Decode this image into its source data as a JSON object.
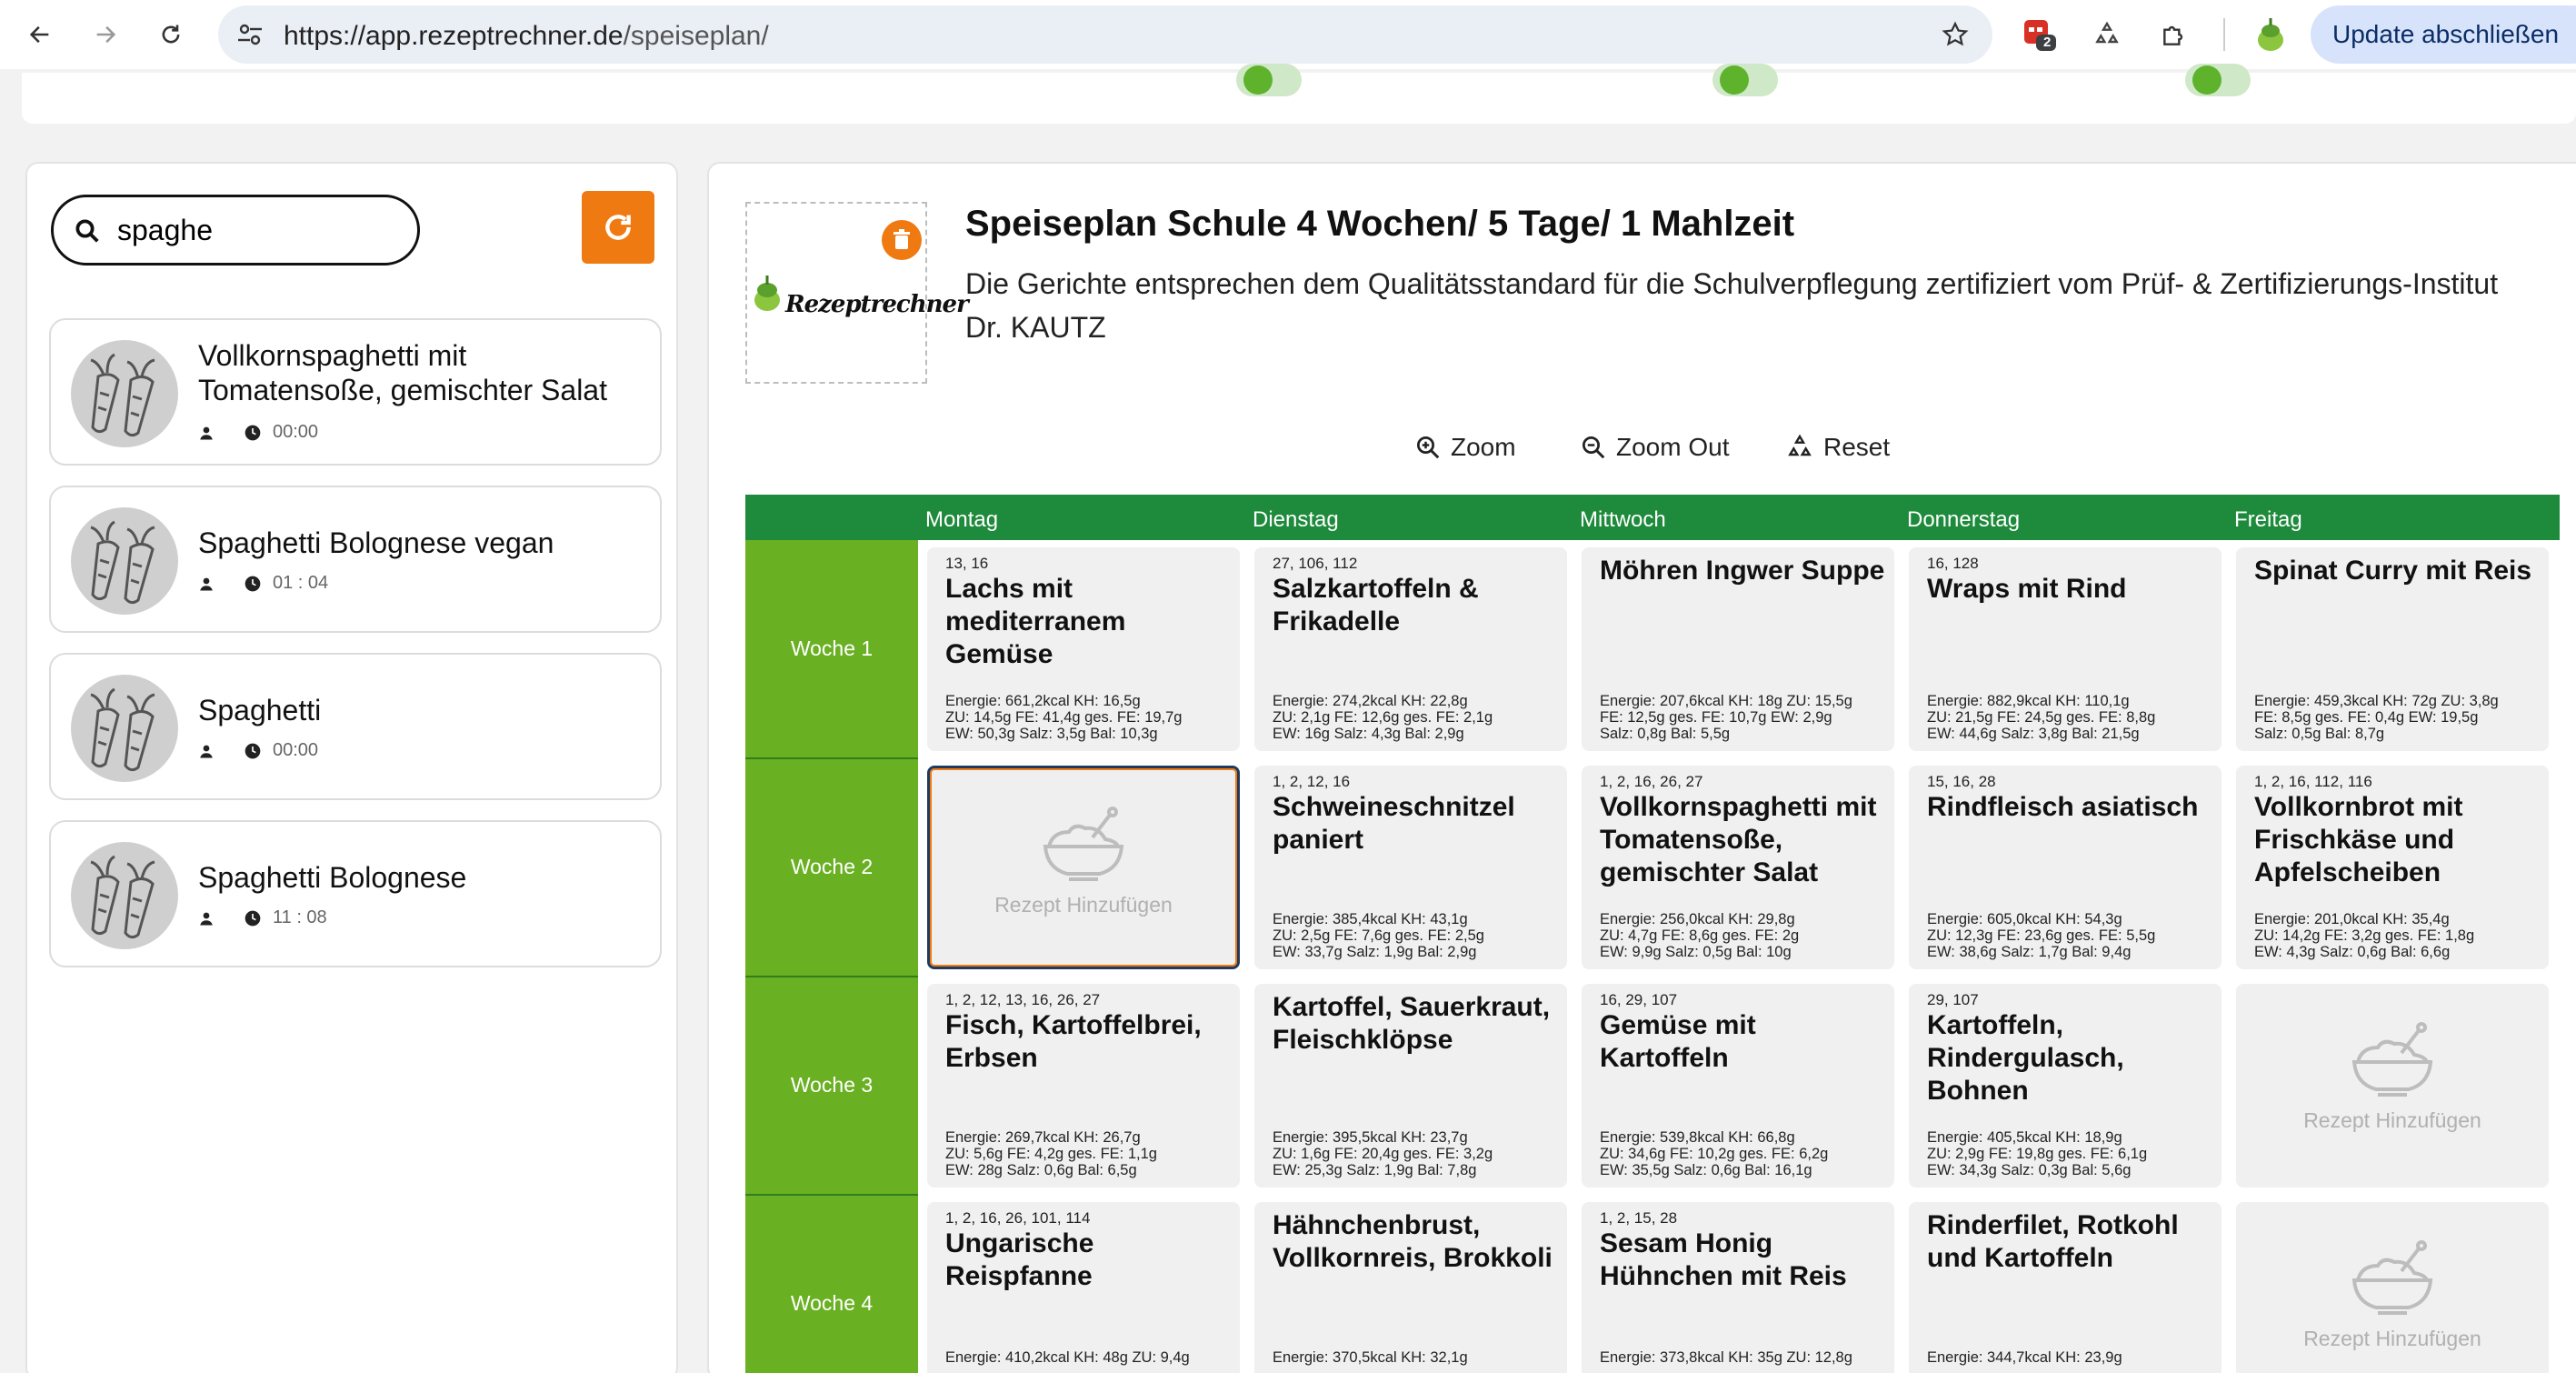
{
  "browser": {
    "url_host": "https://app.rezeptrechner.de",
    "url_path": "/speiseplan/",
    "ext_badge": "2",
    "update_label": "Update abschließen"
  },
  "search": {
    "value": "spaghe",
    "placeholder": ""
  },
  "recipes": [
    {
      "title": "Vollkornspaghetti mit Tomatensoße, gemischter Salat",
      "time": "00:00"
    },
    {
      "title": "Spaghetti Bolognese vegan",
      "time": "01 : 04"
    },
    {
      "title": "Spaghetti",
      "time": "00:00"
    },
    {
      "title": "Spaghetti Bolognese",
      "time": "11 : 08"
    }
  ],
  "plan": {
    "logo_text": "Rezeptrechner",
    "title": "Speiseplan Schule 4 Wochen/ 5 Tage/ 1 Mahlzeit",
    "subtitle": "Die Gerichte entsprechen dem Qualitätsstandard für die Schulverpflegung zertifiziert vom Prüf- & Zertifizierungs-Institut Dr. KAUTZ",
    "zoom_in": "Zoom",
    "zoom_out": "Zoom Out",
    "reset": "Reset",
    "add_label": "Rezept Hinzufügen",
    "days": [
      "Montag",
      "Dienstag",
      "Mittwoch",
      "Donnerstag",
      "Freitag"
    ],
    "weeks": [
      {
        "label": "Woche 1",
        "cells": [
          {
            "nums": "13, 16",
            "title": "Lachs mit mediterranem Gemüse",
            "n1": "Energie: 661,2kcal  KH: 16,5g",
            "n2": "ZU: 14,5g  FE: 41,4g  ges. FE: 19,7g",
            "n3": "EW: 50,3g  Salz: 3,5g  Bal: 10,3g"
          },
          {
            "nums": "27, 106, 112",
            "title": "Salzkartoffeln & Frikadelle",
            "n1": "Energie: 274,2kcal  KH: 22,8g",
            "n2": "ZU: 2,1g  FE: 12,6g  ges. FE: 2,1g",
            "n3": "EW: 16g  Salz: 4,3g  Bal: 2,9g"
          },
          {
            "nums": "",
            "title": "Möhren Ingwer Suppe",
            "n1": "Energie: 207,6kcal  KH: 18g  ZU: 15,5g",
            "n2": "FE: 12,5g  ges. FE: 10,7g  EW: 2,9g",
            "n3": "Salz: 0,8g  Bal: 5,5g"
          },
          {
            "nums": "16, 128",
            "title": "Wraps mit Rind",
            "n1": "Energie: 882,9kcal  KH: 110,1g",
            "n2": "ZU: 21,5g  FE: 24,5g  ges. FE: 8,8g",
            "n3": "EW: 44,6g  Salz: 3,8g  Bal: 21,5g"
          },
          {
            "nums": "",
            "title": "Spinat Curry mit Reis",
            "n1": "Energie: 459,3kcal  KH: 72g  ZU: 3,8g",
            "n2": "FE: 8,5g  ges. FE: 0,4g  EW: 19,5g",
            "n3": "Salz: 0,5g  Bal: 8,7g"
          }
        ]
      },
      {
        "label": "Woche 2",
        "cells": [
          {
            "empty": true
          },
          {
            "nums": "1, 2, 12, 16",
            "title": "Schweineschnitzel paniert",
            "n1": "Energie: 385,4kcal  KH: 43,1g",
            "n2": "ZU: 2,5g  FE: 7,6g  ges. FE: 2,5g",
            "n3": "EW: 33,7g  Salz: 1,9g  Bal: 2,9g"
          },
          {
            "nums": "1, 2, 16, 26, 27",
            "title": "Vollkornspaghetti mit Tomatensoße, gemischter Salat",
            "n1": "Energie: 256,0kcal  KH: 29,8g",
            "n2": "ZU: 4,7g  FE: 8,6g  ges. FE: 2g",
            "n3": "EW: 9,9g  Salz: 0,5g  Bal: 10g"
          },
          {
            "nums": "15, 16, 28",
            "title": "Rindfleisch asiatisch",
            "n1": "Energie: 605,0kcal  KH: 54,3g",
            "n2": "ZU: 12,3g  FE: 23,6g  ges. FE: 5,5g",
            "n3": "EW: 38,6g  Salz: 1,7g  Bal: 9,4g"
          },
          {
            "nums": "1, 2, 16, 112, 116",
            "title": "Vollkornbrot mit Frischkäse und Apfelscheiben",
            "n1": "Energie: 201,0kcal  KH: 35,4g",
            "n2": "ZU: 14,2g  FE: 3,2g  ges. FE: 1,8g",
            "n3": "EW: 4,3g  Salz: 0,6g  Bal: 6,6g"
          }
        ]
      },
      {
        "label": "Woche 3",
        "cells": [
          {
            "nums": "1, 2, 12, 13, 16, 26, 27",
            "title": "Fisch, Kartoffelbrei, Erbsen",
            "n1": "Energie: 269,7kcal  KH: 26,7g",
            "n2": "ZU: 5,6g  FE: 4,2g  ges. FE: 1,1g",
            "n3": "EW: 28g  Salz: 0,6g  Bal: 6,5g"
          },
          {
            "nums": "",
            "title": "Kartoffel, Sauerkraut, Fleischklöpse",
            "n1": "Energie: 395,5kcal  KH: 23,7g",
            "n2": "ZU: 1,6g  FE: 20,4g  ges. FE: 3,2g",
            "n3": "EW: 25,3g  Salz: 1,9g  Bal: 7,8g"
          },
          {
            "nums": "16, 29, 107",
            "title": "Gemüse mit Kartoffeln",
            "n1": "Energie: 539,8kcal  KH: 66,8g",
            "n2": "ZU: 34,6g  FE: 10,2g  ges. FE: 6,2g",
            "n3": "EW: 35,5g  Salz: 0,6g  Bal: 16,1g"
          },
          {
            "nums": "29, 107",
            "title": "Kartoffeln, Rindergulasch, Bohnen",
            "n1": "Energie: 405,5kcal  KH: 18,9g",
            "n2": "ZU: 2,9g  FE: 19,8g  ges. FE: 6,1g",
            "n3": "EW: 34,3g  Salz: 0,3g  Bal: 5,6g"
          },
          {
            "empty": true
          }
        ]
      },
      {
        "label": "Woche 4",
        "cells": [
          {
            "nums": "1, 2, 16, 26, 101, 114",
            "title": "Ungarische Reispfanne",
            "n1": "Energie: 410,2kcal  KH: 48g  ZU: 9,4g",
            "n2": "",
            "n3": ""
          },
          {
            "nums": "",
            "title": "Hähnchenbrust, Vollkornreis, Brokkoli",
            "n1": "Energie: 370,5kcal  KH: 32,1g",
            "n2": "",
            "n3": ""
          },
          {
            "nums": "1, 2, 15, 28",
            "title": "Sesam Honig Hühnchen mit Reis",
            "n1": "Energie: 373,8kcal  KH: 35g  ZU: 12,8g",
            "n2": "",
            "n3": ""
          },
          {
            "nums": "",
            "title": "Rinderfilet, Rotkohl und Kartoffeln",
            "n1": "Energie: 344,7kcal  KH: 23,9g",
            "n2": "",
            "n3": ""
          },
          {
            "empty": true
          }
        ]
      }
    ]
  }
}
